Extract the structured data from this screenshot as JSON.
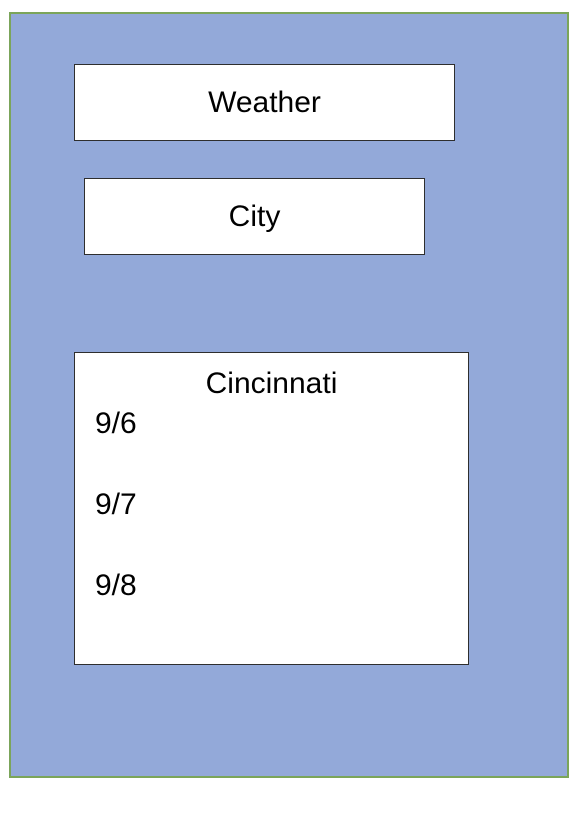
{
  "app": {
    "title": "Weather"
  },
  "search": {
    "value": "City"
  },
  "forecast": {
    "city": "Cincinnati",
    "days": [
      {
        "date": "9/6"
      },
      {
        "date": "9/7"
      },
      {
        "date": "9/8"
      }
    ]
  },
  "colors": {
    "background": "#93a9d9",
    "frame_border": "#7ba55a",
    "card": "#ffffff",
    "text": "#000000"
  }
}
